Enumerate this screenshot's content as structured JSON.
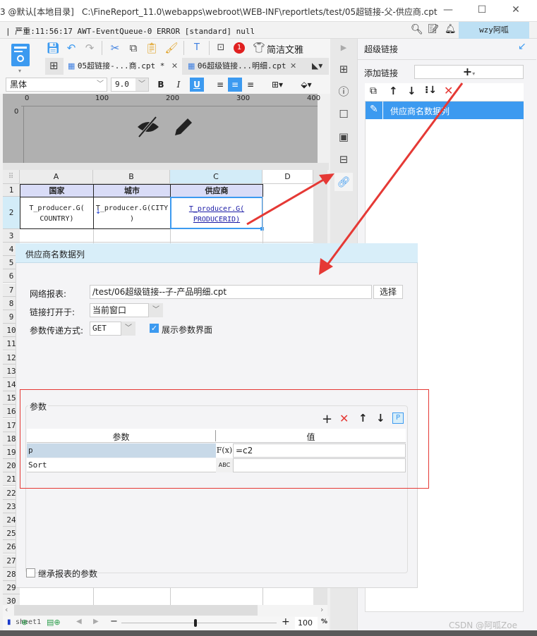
{
  "window": {
    "title_prefix": "3 @默认[本地目录]",
    "title_path": "C:\\FineReport_11.0\\webapps\\webroot\\WEB-INF\\reportlets/test/05超链接-父-供应商.cpt",
    "minimize": "—",
    "maximize": "☐",
    "close": "✕"
  },
  "logbar": {
    "message": "| 严重:11:56:17 AWT-EventQueue-0 ERROR [standard] null",
    "user": "wzy阿呱"
  },
  "toolbar": {
    "badge_count": "1",
    "theme_label": "简洁文雅",
    "tabs": [
      {
        "label": "05超链接-...商.cpt *",
        "active": true
      },
      {
        "label": "06超级链接...明细.cpt",
        "active": false
      }
    ],
    "font_name": "黑体",
    "font_size": "9.0",
    "bold": "B",
    "italic": "I",
    "underline": "U"
  },
  "ruler": {
    "h_labels": [
      "0",
      "100",
      "200",
      "300",
      "400"
    ],
    "v_label": "0"
  },
  "sheet": {
    "columns": [
      "A",
      "B",
      "C",
      "D"
    ],
    "rows": [
      "1",
      "2",
      "3",
      "4",
      "5",
      "6",
      "7",
      "8",
      "9",
      "10",
      "11",
      "12",
      "13",
      "14",
      "15",
      "16",
      "17",
      "18",
      "19",
      "20",
      "21",
      "22",
      "23",
      "24",
      "25",
      "26",
      "27",
      "28",
      "29",
      "30"
    ],
    "headers": [
      "国家",
      "城市",
      "供应商"
    ],
    "row2": [
      "T_producer.G(\nCOUNTRY)",
      "T_producer.G(CITY\n)",
      "T_producer.G(\nPRODUCERID)"
    ],
    "zoom_value": "100",
    "zoom_unit": "%",
    "sheet_tab": "sheet1"
  },
  "right_panel": {
    "title": "超级链接",
    "add_link_label": "添加链接",
    "add_symbol": "+",
    "links": [
      {
        "label": "供应商名数据列",
        "selected": true
      }
    ]
  },
  "dialog": {
    "title": "供应商名数据列",
    "report_label": "网络报表:",
    "report_value": "/test/06超级链接--子-产品明细.cpt",
    "choose_button": "选择",
    "open_in_label": "链接打开于:",
    "open_in_value": "当前窗口",
    "method_label": "参数传递方式:",
    "method_value": "GET",
    "show_params_label": "展示参数界面",
    "show_params_checked": true,
    "params_group_label": "参数",
    "params_table": {
      "headers": [
        "参数",
        "值"
      ],
      "rows": [
        {
          "name": "p",
          "type_icon": "F(x)",
          "value": "=c2",
          "selected": true
        },
        {
          "name": "Sort",
          "type_icon": "ABC",
          "value": "",
          "selected": false
        }
      ]
    },
    "inherit_label": "继承报表的参数",
    "inherit_checked": false
  },
  "watermark": "CSDN @阿呱Zoe",
  "colors": {
    "accent": "#3c9af0",
    "selection_blue": "#3c9af0",
    "header_fill": "#d9dcf7",
    "dialog_header": "#d8eef9",
    "annotation_red": "#e53935",
    "link_text": "#1a1aa6"
  }
}
